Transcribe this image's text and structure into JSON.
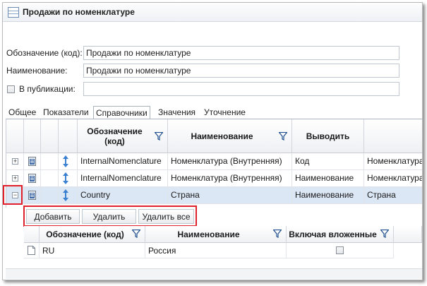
{
  "window": {
    "title": "Продажи по номенклатуре",
    "icon": "table-icon"
  },
  "form": {
    "code_label": "Обозначение (код):",
    "code_value": "Продажи по номенклатуре",
    "name_label": "Наименование:",
    "name_value": "Продажи по номенклатуре",
    "publish_label": "В публикации:",
    "publish_checked": false,
    "publish_value": ""
  },
  "tabs": [
    {
      "label": "Общее",
      "active": false
    },
    {
      "label": "Показатели",
      "active": false
    },
    {
      "label": "Справочники",
      "active": true
    },
    {
      "label": "Значения",
      "active": false
    },
    {
      "label": "Уточнение",
      "active": false
    }
  ],
  "grid": {
    "columns": [
      "Обозначение (код)",
      "Наименование",
      "Выводить",
      ""
    ],
    "rows": [
      {
        "expander": "+",
        "code": "InternalNomenclature",
        "name": "Номенклатура (Внутренняя)",
        "output": "Код",
        "extra": "Номенклатура",
        "selected": false
      },
      {
        "expander": "+",
        "code": "InternalNomenclature",
        "name": "Номенклатура (Внутренняя)",
        "output": "Наименование",
        "extra": "Номенклатура",
        "selected": false
      },
      {
        "expander": "−",
        "code": "Country",
        "name": "Страна",
        "output": "Наименование",
        "extra": "Страна",
        "selected": true
      }
    ]
  },
  "buttons": {
    "add": "Добавить",
    "delete": "Удалить",
    "delete_all": "Удалить все"
  },
  "subgrid": {
    "columns": [
      "Обозначение (код)",
      "Наименование",
      "Включая вложенные"
    ],
    "rows": [
      {
        "code": "RU",
        "name": "Россия",
        "include_nested": false
      }
    ]
  },
  "colors": {
    "highlight": "#e0202a",
    "selected_row": "#dce7f5",
    "arrow_blue": "#3a7fd0"
  }
}
